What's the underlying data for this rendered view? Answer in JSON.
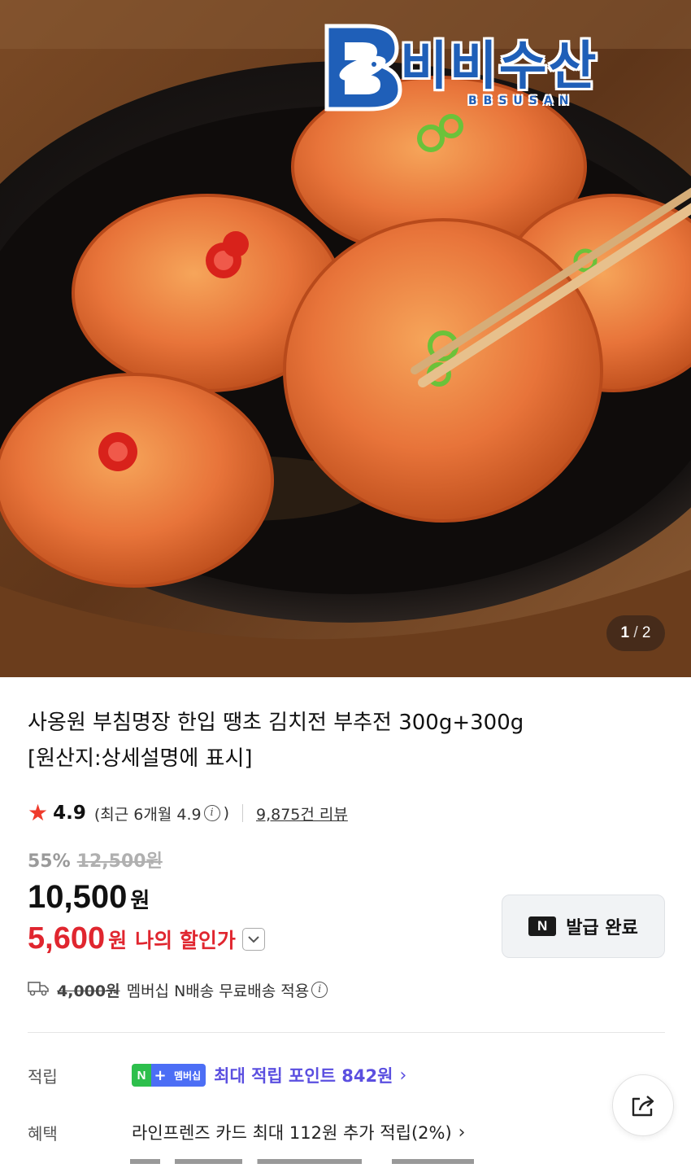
{
  "hero": {
    "brand_name": "비비수산",
    "brand_sub": "BBSUSAN",
    "image_counter": {
      "current": "1",
      "separator": "/",
      "total": "2"
    }
  },
  "product": {
    "title_line1": "사옹원 부침명장 한입 땡초 김치전 부추전 300g+300g",
    "title_line2": "[원산지:상세설명에 표시]"
  },
  "rating": {
    "star_icon": "star-icon",
    "score": "4.9",
    "recent_prefix": "(최근 6개월 4.9",
    "info_glyph": "i",
    "recent_suffix": ")",
    "reviews": "9,875건 리뷰"
  },
  "pricing": {
    "discount_percent": "55%",
    "original_price": "12,500원",
    "price": "10,500",
    "price_unit": "원",
    "my_price": "5,600",
    "my_price_unit": "원",
    "my_price_label": "나의 할인가"
  },
  "coupon": {
    "badge": "N",
    "label": "발급 완료"
  },
  "shipping": {
    "original_fee": "4,000원",
    "text": "멤버십 N배송 무료배송 적용"
  },
  "points": {
    "label": "적립",
    "badge_n": "N",
    "badge_plus": "+",
    "badge_text": "멤버십",
    "text": "최대 적립 포인트 842원",
    "chevron": "›"
  },
  "benefit": {
    "label": "혜택",
    "text": "라인프렌즈 카드 최대 112원 추가 적립(2%)",
    "chevron": "›"
  },
  "colors": {
    "accent_red": "#e0262f",
    "points_purple": "#5b4fe0",
    "brand_blue": "#1f5fb8",
    "membership_green": "#2dbf4c"
  }
}
